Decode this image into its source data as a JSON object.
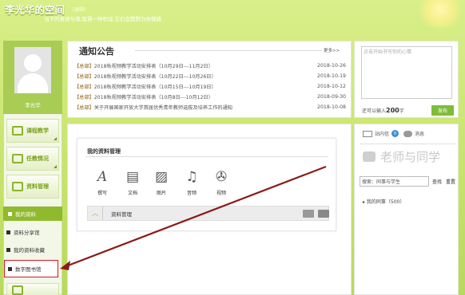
{
  "header": {
    "title": "李光华的空间",
    "edit": "[编辑]",
    "motto": "当下的奋进与落,智慧一种积淀,它们会默默为你辅路"
  },
  "profile": {
    "name": "李光华"
  },
  "sidebar": {
    "sections": [
      {
        "label": "课程教学"
      },
      {
        "label": "任教情况"
      },
      {
        "label": "资料管理"
      }
    ],
    "sub_items": [
      {
        "label": "我的资料"
      },
      {
        "label": "资料分享馆"
      },
      {
        "label": "我的资料收藏"
      },
      {
        "label": "数字图书馆"
      }
    ]
  },
  "notice": {
    "title": "通知公告",
    "more": "更多>>",
    "items": [
      {
        "tag": "【总部】",
        "text": "2018秋视频教学活动安排表（10月29日---11月2日）",
        "date": "2018-10-26"
      },
      {
        "tag": "【总部】",
        "text": "2018秋视频教学活动安排表（10月22日---10月26日）",
        "date": "2018-10-19"
      },
      {
        "tag": "【总部】",
        "text": "2018秋视频教学活动安排表（10月15日---10月19日）",
        "date": "2018-10-12"
      },
      {
        "tag": "【总部】",
        "text": "2018秋视频教学活动安排表（10月8日---10月12日）",
        "date": "2018-09-30"
      },
      {
        "tag": "【总部】",
        "text": "关于开展国家开放大学首届优秀青年教师选拔及培养工作的通知",
        "date": "2018-10-08"
      }
    ]
  },
  "mood": {
    "placeholder": "点击开始书写你的心情",
    "hint_prefix": "还可以输入",
    "count": "200",
    "hint_suffix": "字",
    "submit": "发布"
  },
  "resources": {
    "title": "我的资料管理",
    "items": [
      {
        "label": "撰写",
        "icon": "write-icon",
        "glyph": "A"
      },
      {
        "label": "文档",
        "icon": "document-icon",
        "glyph": "▤"
      },
      {
        "label": "图片",
        "icon": "picture-icon",
        "glyph": "▨"
      },
      {
        "label": "音频",
        "icon": "audio-icon",
        "glyph": "♫"
      },
      {
        "label": "视频",
        "icon": "video-icon",
        "glyph": "✇"
      }
    ],
    "bar_label": "资料管理"
  },
  "social": {
    "inbox_label": "站内信",
    "inbox_count": "0",
    "message_label": "消息",
    "title": "老师与同学",
    "search_value": "搜索：同事与学生",
    "search_btn": "查找",
    "reset_btn": "重置",
    "group": "我的同事（500）"
  },
  "colors": {
    "accent": "#8cb526",
    "highlight": "#d6171e",
    "arrow": "#8b1a1a"
  }
}
